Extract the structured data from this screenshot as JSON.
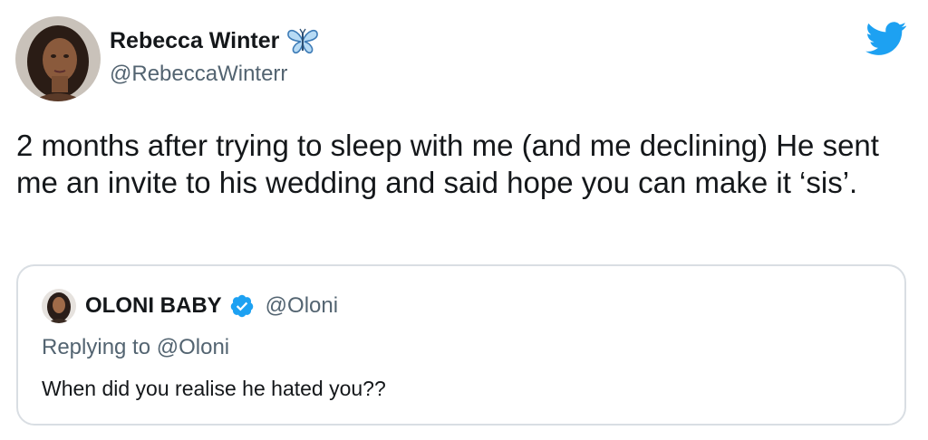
{
  "tweet": {
    "author": {
      "display_name": "Rebecca Winter",
      "handle": "@RebeccaWinterr",
      "name_emoji": "butterfly-icon"
    },
    "text": "2 months after trying to sleep with me (and me declining) He sent me an invite to his wedding and said hope you can make it ‘sis’.",
    "brand_icon": "twitter-bird-icon",
    "colors": {
      "brand_blue": "#1da1f2",
      "text": "#14171a",
      "secondary_text": "#536471",
      "border": "#d9dee3"
    }
  },
  "quoted_tweet": {
    "author": {
      "display_name": "OLONI BABY",
      "handle": "@Oloni",
      "verified": true
    },
    "reply_prefix": "Replying to",
    "reply_to": "@Oloni",
    "text": "When did you realise he hated you??"
  }
}
